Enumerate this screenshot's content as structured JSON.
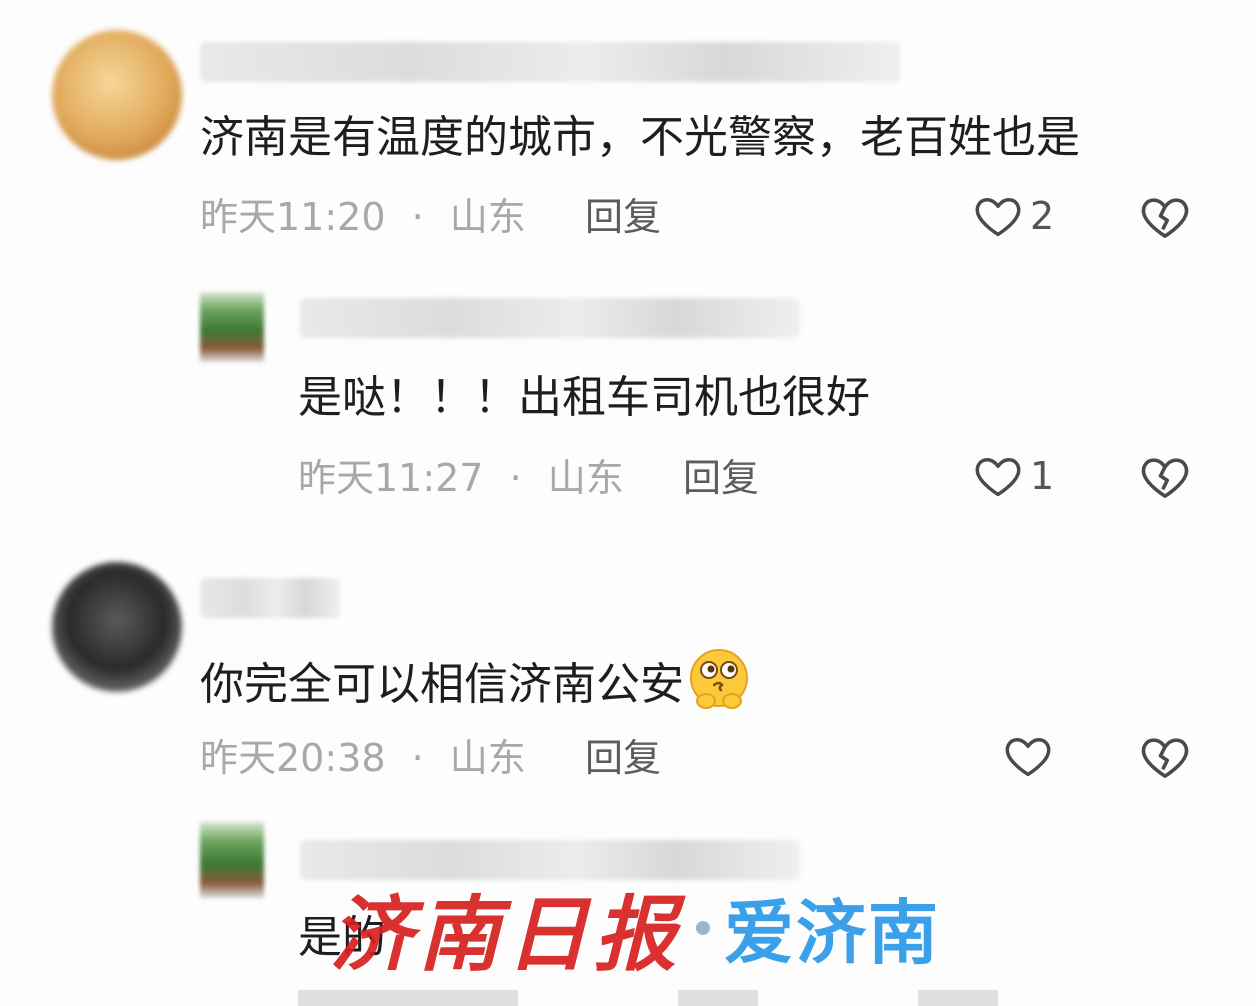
{
  "comments": [
    {
      "text": "济南是有温度的城市，不光警察，老百姓也是",
      "time": "昨天11:20",
      "location": "山东",
      "reply_label": "回复",
      "likes": "2",
      "reply": {
        "text": "是哒！！！出租车司机也很好",
        "time": "昨天11:27",
        "location": "山东",
        "reply_label": "回复",
        "likes": "1"
      }
    },
    {
      "text": "你完全可以相信济南公安",
      "emoji": "thinking-face-emoji",
      "time": "昨天20:38",
      "location": "山东",
      "reply_label": "回复",
      "likes": "",
      "reply": {
        "text": "是的"
      }
    }
  ],
  "separator": "·",
  "watermark": {
    "left_text": "济南日报",
    "right_text": "爱济南",
    "colors": {
      "left": "#d61f1f",
      "right": "#3aa0ea"
    }
  },
  "icons": {
    "like": "heart-outline-icon",
    "dislike": "broken-heart-icon"
  }
}
